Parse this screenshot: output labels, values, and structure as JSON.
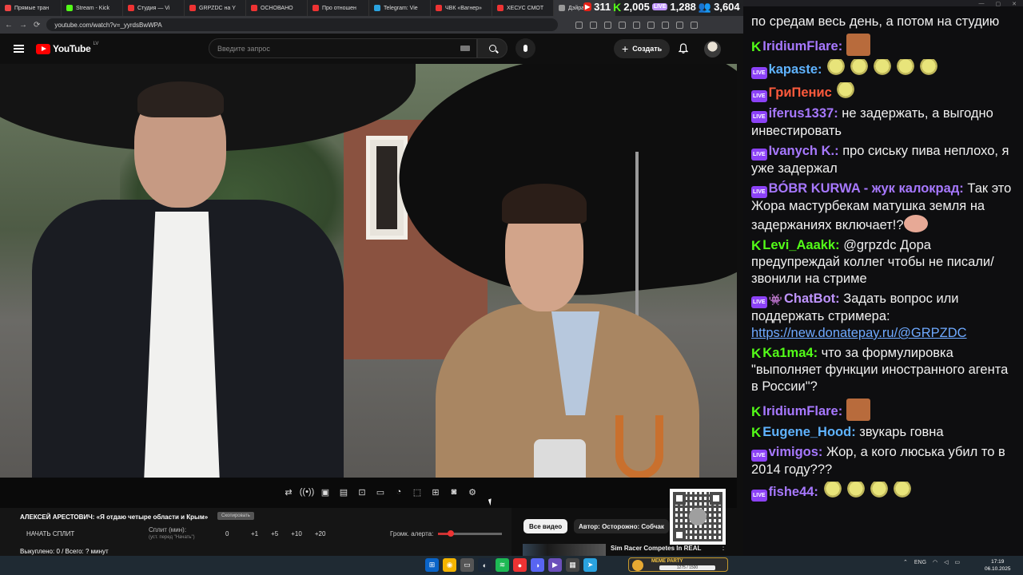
{
  "browser": {
    "tabs": [
      {
        "label": "Прямые тран",
        "color": "#e44"
      },
      {
        "label": "Stream - Kick",
        "color": "#53fc18"
      },
      {
        "label": "Студия — Vi",
        "color": "#e33"
      },
      {
        "label": "GRPZDC на Y",
        "color": "#e33"
      },
      {
        "label": "ОСНОВАНО",
        "color": "#e33"
      },
      {
        "label": "Про отношен",
        "color": "#e33"
      },
      {
        "label": "Telegram: Vie",
        "color": "#2aa3e0"
      },
      {
        "label": "ЧВК «Вагнер»",
        "color": "#e33"
      },
      {
        "label": "ХЕСУС СМОТ",
        "color": "#e33"
      },
      {
        "label": "Дэйра",
        "color": "#999"
      }
    ],
    "url": "youtube.com/watch?v=_yyrdsBwWPA"
  },
  "youtube": {
    "logo_text": "YouTube",
    "country_code": "LV",
    "search_placeholder": "Введите запрос",
    "create_label": "Создать"
  },
  "split_panel": {
    "title": "АЛЕКСЕЙ АРЕСТОВИЧ: «Я отдаю четыре области и Крым»",
    "copy_badge": "Скопировать",
    "start_split": "НАЧАТЬ СПЛИТ",
    "split_min_label": "Сплит (мин):",
    "split_hint": "(уст. перед \"Начать\")",
    "split_value": "0",
    "increments": [
      "+1",
      "+5",
      "+10",
      "+20"
    ],
    "alert_volume_label": "Громк. алерта:",
    "alert_volume_level": 0.2,
    "bought": "Выкуплено: 0 / Всего: ? минут"
  },
  "recs": {
    "chip_all": "Все видео",
    "chip_author": "Автор: Осторожно: Собчак",
    "rec_title": "Sim Racer Competes In REAL"
  },
  "stats": {
    "youtube_viewers": "311",
    "kick_viewers": "2,005",
    "twitch_viewers": "1,288",
    "total_viewers": "3,604"
  },
  "chat": {
    "messages": [
      {
        "platform": "none",
        "user": "",
        "user_color": "#f0f0f0",
        "text": "по средам весь день, а потом на студию",
        "emotes": []
      },
      {
        "platform": "kick",
        "user": "IridiumFlare:",
        "user_color": "#a778ff",
        "text": "",
        "emotes": [
          "sad"
        ]
      },
      {
        "platform": "live",
        "user": "kapaste:",
        "user_color": "#5fb3ff",
        "text": "",
        "emotes": [
          "pepe",
          "pepe",
          "pepe",
          "pepe",
          "pepe"
        ]
      },
      {
        "platform": "live",
        "user": "ГриПенис",
        "user_color": "#ff5a3c",
        "text": "",
        "emotes": [
          "pepe"
        ]
      },
      {
        "platform": "live",
        "user": "iferus1337:",
        "user_color": "#a778ff",
        "text": "не задержать, а выгодно инвестировать",
        "emotes": []
      },
      {
        "platform": "live",
        "user": "Ivanych K.:",
        "user_color": "#a778ff",
        "text": "про сиську пива неплохо, я уже задержал",
        "emotes": []
      },
      {
        "platform": "live",
        "user": "BÓBR KURWA - жук калокрад:",
        "user_color": "#a778ff",
        "text": "Так это Жора мастурбекам матушка земля на задержаниях включает!?",
        "emotes": [
          "lips"
        ]
      },
      {
        "platform": "kick",
        "user": "Levi_Aaakk:",
        "user_color": "#53fc18",
        "text": "@grpzdc Дора предупреждай коллег чтобы не писали/звонили на стриме",
        "emotes": []
      },
      {
        "platform": "bot",
        "user": "ChatBot:",
        "user_color": "#bf94ff",
        "text": "Задать вопрос или поддержать стримера:",
        "link": "https://new.donatepay.ru/@GRPZDC",
        "emotes": []
      },
      {
        "platform": "kick",
        "user": "Ka1ma4:",
        "user_color": "#53fc18",
        "text": "что за формулировка \"выполняет функции иностранного агента в России\"?",
        "emotes": []
      },
      {
        "platform": "kick",
        "user": "IridiumFlare:",
        "user_color": "#a778ff",
        "text": "",
        "emotes": [
          "sad"
        ]
      },
      {
        "platform": "kick",
        "user": "Eugene_Hood:",
        "user_color": "#5fb3ff",
        "text": "звукарь говна",
        "emotes": []
      },
      {
        "platform": "live",
        "user": "vimigos:",
        "user_color": "#a778ff",
        "text": "Жор, а кого люська убил то в 2014 году???",
        "emotes": []
      },
      {
        "platform": "live",
        "user": "fishe44:",
        "user_color": "#a778ff",
        "text": "",
        "emotes": [
          "pepe",
          "pepe",
          "pepe",
          "pepe"
        ]
      }
    ]
  },
  "hype": {
    "label": "MEME PARTY",
    "progress": "1275 / 1500"
  },
  "taskbar": {
    "lang": "ENG",
    "time": "17:19",
    "date": "06.10.2025"
  }
}
